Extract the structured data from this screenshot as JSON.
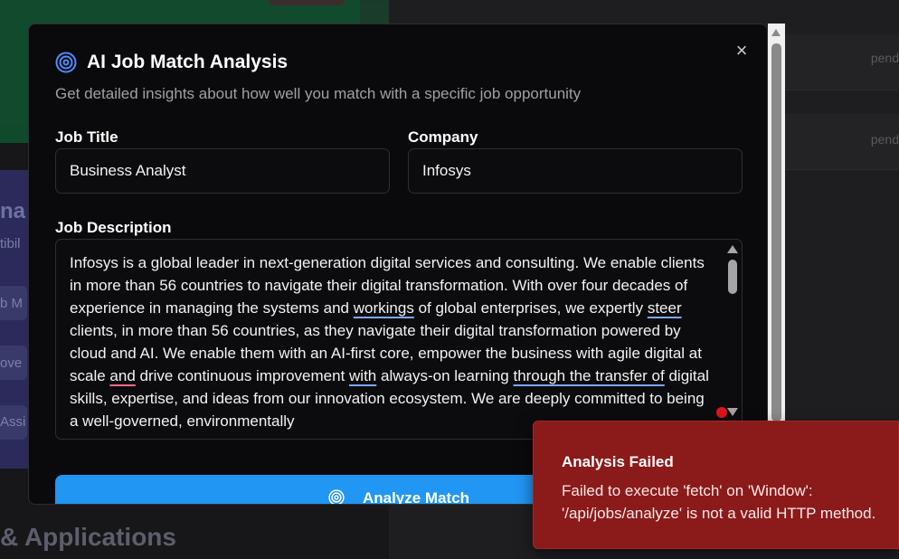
{
  "background": {
    "sidebar_fragments": [
      "na",
      "tibil",
      "b M",
      "ove",
      "Assi"
    ],
    "section_heading": "& Applications",
    "status_labels": [
      "pend",
      "pend"
    ]
  },
  "modal": {
    "title": "AI Job Match Analysis",
    "subtitle": "Get detailed insights about how well you match with a specific job opportunity",
    "close_icon": "×",
    "job_title": {
      "label": "Job Title",
      "value": "Business Analyst"
    },
    "company": {
      "label": "Company",
      "value": "Infosys"
    },
    "job_description": {
      "label": "Job Description",
      "value": "Infosys is a global leader in next-generation digital services and consulting. We enable clients in more than 56 countries to navigate their digital transformation. With over four decades of experience in managing the systems and workings of global enterprises, we expertly steer clients, in more than 56 countries, as they navigate their digital transformation powered by cloud and AI. We enable them with an AI-first core, empower the business with agile digital at scale and drive continuous improvement with always-on learning through the transfer of digital skills, expertise, and ideas from our innovation ecosystem. We are deeply committed to being a well-governed, environmentally"
    },
    "analyze_button": "Analyze Match"
  },
  "toast": {
    "title": "Analysis Failed",
    "message": "Failed to execute 'fetch' on 'Window': '/api/jobs/analyze' is not a valid HTTP method."
  },
  "colors": {
    "accent": "#2196f3",
    "toast_bg": "#8b1a1a",
    "modal_bg": "#0a0a0c"
  }
}
